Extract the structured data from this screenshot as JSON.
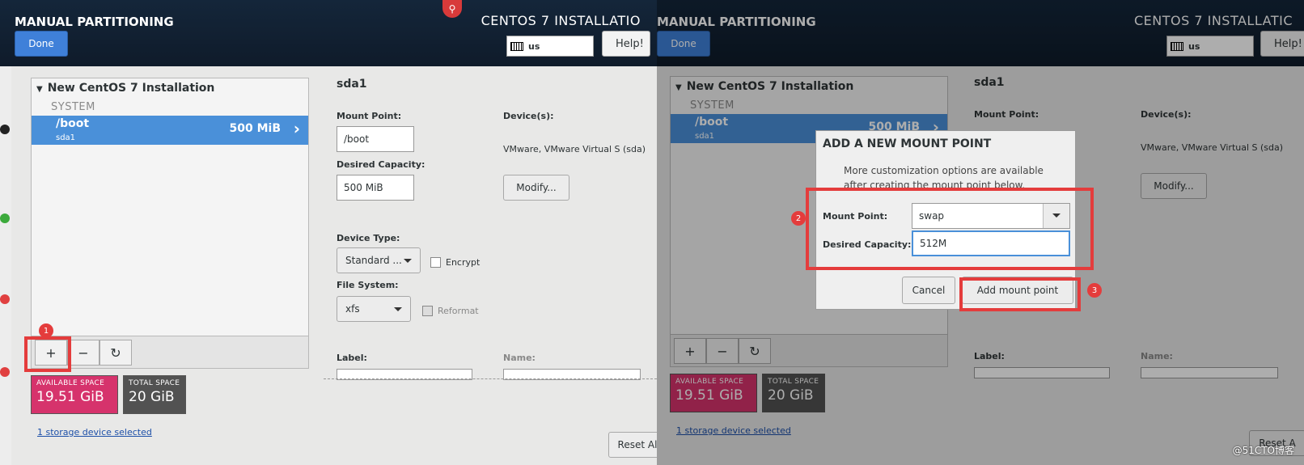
{
  "left": {
    "header": {
      "title": "MANUAL PARTITIONING",
      "done_label": "Done",
      "install_title": "CENTOS 7 INSTALLATIO",
      "keyboard": "us",
      "help_label": "Help!"
    },
    "tree": {
      "installation": "New CentOS 7 Installation",
      "section": "SYSTEM",
      "row": {
        "mount": "/boot",
        "device": "sda1",
        "size": "500 MiB"
      }
    },
    "toolbar": {
      "add": "+",
      "remove": "−",
      "refresh": "↻"
    },
    "space": {
      "available_label": "AVAILABLE SPACE",
      "available_value": "19.51 GiB",
      "total_label": "TOTAL SPACE",
      "total_value": "20 GiB"
    },
    "storage_link": "1 storage device selected",
    "reset_label": "Reset Al",
    "detail": {
      "title": "sda1",
      "mount_point_label": "Mount Point:",
      "mount_point_value": "/boot",
      "capacity_label": "Desired Capacity:",
      "capacity_value": "500 MiB",
      "devices_label": "Device(s):",
      "devices_value": "VMware, VMware Virtual S (sda)",
      "modify_label": "Modify...",
      "device_type_label": "Device Type:",
      "device_type_value": "Standard ...",
      "encrypt_label": "Encrypt",
      "file_system_label": "File System:",
      "file_system_value": "xfs",
      "reformat_label": "Reformat",
      "label_label": "Label:",
      "name_label": "Name:"
    },
    "annotation_1": "1"
  },
  "right": {
    "header": {
      "title": "MANUAL PARTITIONING",
      "done_label": "Done",
      "install_title": "CENTOS 7 INSTALLATIC",
      "keyboard": "us",
      "help_label": "Help!"
    },
    "tree": {
      "installation": "New CentOS 7 Installation",
      "section": "SYSTEM",
      "row": {
        "mount": "/boot",
        "device": "sda1",
        "size": "500 MiB"
      }
    },
    "toolbar": {
      "add": "+",
      "remove": "−",
      "refresh": "↻"
    },
    "space": {
      "available_label": "AVAILABLE SPACE",
      "available_value": "19.51 GiB",
      "total_label": "TOTAL SPACE",
      "total_value": "20 GiB"
    },
    "storage_link": "1 storage device selected",
    "reset_label": "Reset A",
    "detail": {
      "title": "sda1",
      "mount_point_label": "Mount Point:",
      "devices_label": "Device(s):",
      "devices_value": "VMware, VMware Virtual S (sda)",
      "modify_label": "Modify...",
      "label_label": "Label:",
      "name_label": "Name:"
    },
    "dialog": {
      "title": "ADD A NEW MOUNT POINT",
      "description": "More customization options are available after creating the mount point below.",
      "mount_point_label": "Mount Point:",
      "mount_point_value": "swap",
      "capacity_label": "Desired Capacity:",
      "capacity_value": "512M",
      "cancel_label": "Cancel",
      "add_label": "Add mount point"
    },
    "annotation_2": "2",
    "annotation_3": "3"
  },
  "watermark": "@51CTO博客",
  "colors": {
    "header": "#0f1b2a",
    "accent": "#4a90d9",
    "available": "#d6336c",
    "total": "#525252",
    "annotation": "#e43c3c"
  }
}
